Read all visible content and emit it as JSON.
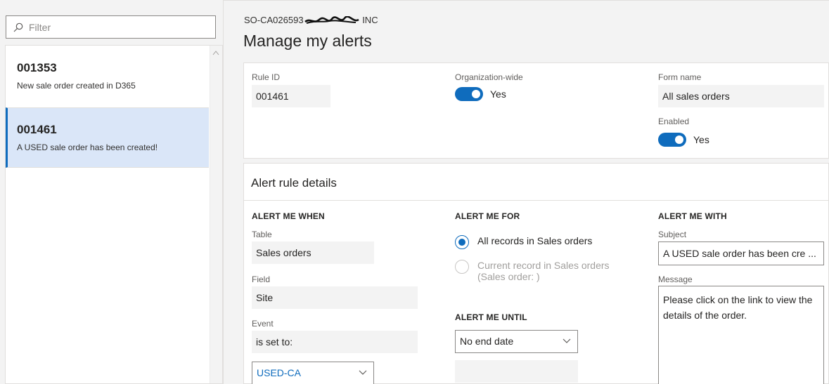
{
  "filter": {
    "placeholder": "Filter"
  },
  "list": [
    {
      "id": "001353",
      "description": "New sale order created in D365"
    },
    {
      "id": "001461",
      "description": "A USED sale order has been created!"
    }
  ],
  "header": {
    "breadcrumb_prefix": "SO-CA026593",
    "breadcrumb_suffix": "INC",
    "title": "Manage my alerts"
  },
  "rule": {
    "rule_id_label": "Rule ID",
    "rule_id": "001461",
    "org_wide_label": "Organization-wide",
    "org_wide_value": "Yes",
    "form_name_label": "Form name",
    "form_name": "All sales orders",
    "enabled_label": "Enabled",
    "enabled_value": "Yes"
  },
  "details": {
    "section_title": "Alert rule details",
    "alert_when": {
      "heading": "ALERT ME WHEN",
      "table_label": "Table",
      "table_value": "Sales orders",
      "field_label": "Field",
      "field_value": "Site",
      "event_label": "Event",
      "event_value": "is set to:",
      "value_select": "USED-CA"
    },
    "alert_for": {
      "heading": "ALERT ME FOR",
      "option1": "All records in Sales orders",
      "option2_line1": "Current record in Sales orders",
      "option2_line2": "(Sales order: )"
    },
    "alert_until": {
      "heading": "ALERT ME UNTIL",
      "select_value": "No end date",
      "date_value": ""
    },
    "alert_with": {
      "heading": "ALERT ME WITH",
      "subject_label": "Subject",
      "subject_value": "A USED sale order has been cre ...",
      "message_label": "Message",
      "message_value": "Please click on the link to view the details of the order."
    }
  },
  "colors": {
    "accent": "#0f6cbd",
    "selected_bg": "#dae6f8"
  },
  "icons": {
    "filter": "search-icon",
    "select": "chevron-down-icon",
    "scroll": "scroll-up-icon"
  }
}
